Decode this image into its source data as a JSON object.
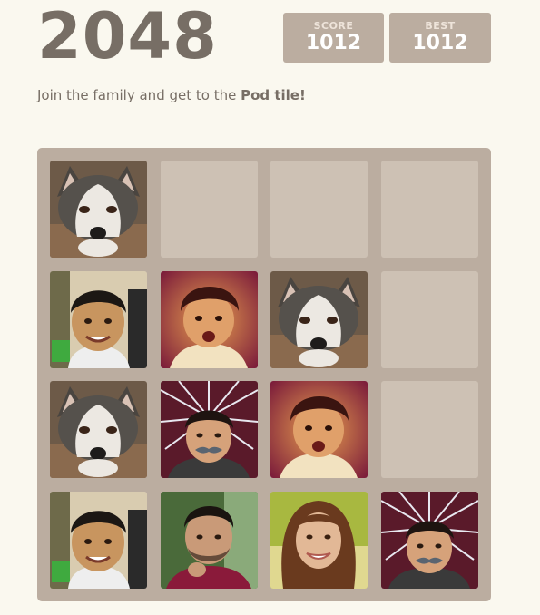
{
  "header": {
    "title": "2048",
    "score_label": "SCORE",
    "score_value": "1012",
    "best_label": "BEST",
    "best_value": "1012"
  },
  "intro": {
    "text": "Join the family and get to the ",
    "highlight": "Pod tile!"
  },
  "board": {
    "size": 4,
    "rows": [
      [
        "husky-dog",
        "empty",
        "empty",
        "empty"
      ],
      [
        "boy-portrait",
        "toddler-portrait",
        "husky-dog",
        "empty"
      ],
      [
        "husky-dog",
        "mustache-man-portrait",
        "toddler-portrait",
        "empty"
      ],
      [
        "boy-portrait",
        "young-man-portrait",
        "woman-portrait",
        "mustache-man-portrait"
      ]
    ]
  },
  "colors": {
    "background": "#faf8ef",
    "board": "#bbada0",
    "empty_cell": "#cdc1b4",
    "text": "#776e65"
  }
}
